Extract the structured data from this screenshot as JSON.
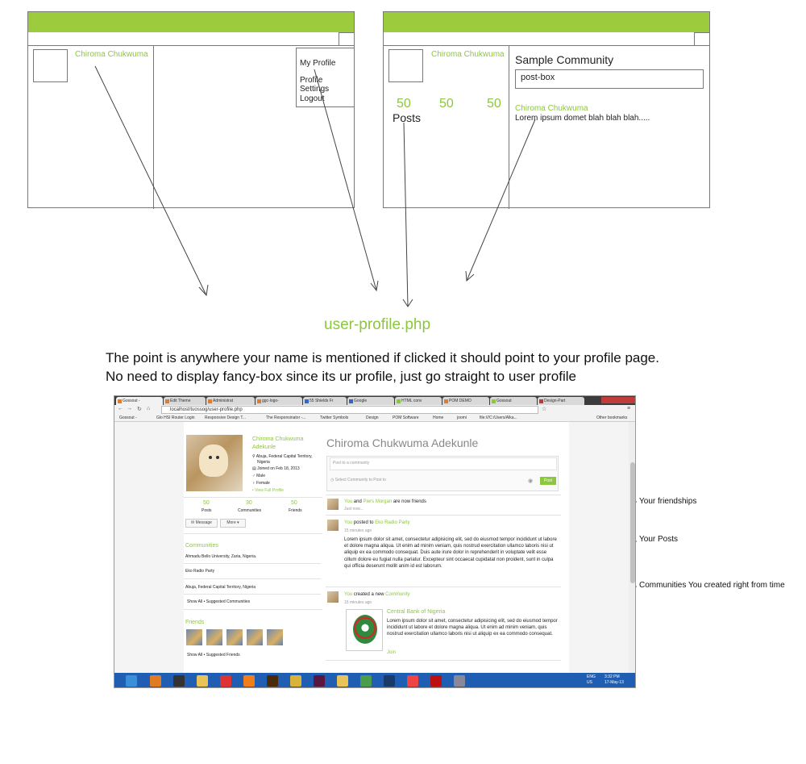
{
  "wireframe_left": {
    "user_name": "Chiroma Chukwuma",
    "menu": [
      "My Profile",
      "Profile Settings",
      "Logout"
    ]
  },
  "wireframe_right": {
    "user_name": "Chiroma Chukwuma",
    "stats": [
      "50",
      "50",
      "50"
    ],
    "posts_label": "Posts",
    "community_title": "Sample Community",
    "post_box": "post-box",
    "post_author": "Chiroma Chukwuma",
    "post_text": "Lorem ipsum domet blah blah blah....."
  },
  "file_label": "user-profile.php",
  "note_lines": [
    "The point is anywhere your name is mentioned if clicked it should point to your profile page.",
    "No need to display fancy-box since its ur profile, just go straight to user profile"
  ],
  "side_labels": {
    "friendships": "Your friendships",
    "posts": "Your Posts",
    "communities": "Communities You created right from time"
  },
  "browser": {
    "tabs": [
      "Gossout -",
      "Edit Theme",
      "Administrat",
      "ggc-logo-",
      "55 Shields Fr",
      "Google",
      "HTML conv",
      "POM DEMO",
      "Gossout",
      "Design-Part"
    ],
    "url": "localhost/tuossog/user-profile.php",
    "bookmarks": [
      "Gossout -",
      "Glo HSI Router Login",
      "Responsive Design T...",
      "The Responsinator -...",
      "Twitter Symbols",
      "Design",
      "POM Software",
      "Home",
      "joomi",
      "file:///C:/Users/Alka...",
      "Other bookmarks"
    ]
  },
  "profile": {
    "name_line1": "Chiroma Chukwuma",
    "name_line2": "Adekunle",
    "location_line1": "Abuja, Federal Capital Territory,",
    "location_line2": "Nigeria",
    "joined": "Joined on Feb 18, 2013",
    "gender1": "Male",
    "gender2": "Female",
    "view_full": "View Full Profile",
    "stats": [
      {
        "value": "50",
        "label": "Posts"
      },
      {
        "value": "30",
        "label": "Communities"
      },
      {
        "value": "50",
        "label": "Friends"
      }
    ],
    "message_btn": "Message",
    "more_btn": "More",
    "communities_title": "Communities",
    "communities": [
      "Ahmadu Bello University, Zaria, Nigeria.",
      "Eko Radio Party",
      "Abuja, Federal Capital Territory, Nigeria"
    ],
    "communities_links": "Show All  •  Suggested Communities",
    "friends_title": "Friends",
    "friends_links": "Show All  •  Suggested Friends"
  },
  "feed": {
    "heading": "Chiroma Chukwuma Adekunle",
    "post_placeholder": "Post to a community",
    "select_community": "Select Community to Post to",
    "post_button": "Post",
    "item1": {
      "you": "You",
      "and": "and",
      "name": "Piers Morgan",
      "rest": "are now friends",
      "time": "Just now..."
    },
    "item2": {
      "you": "You",
      "action": "posted to",
      "target": "Eko Radio Party",
      "time": "15 minutes ago",
      "body": "Lorem ipsum dolor sit amet, consectetur adipisicing elit, sed do eiusmod tempor incididunt ut labore et dolore magna aliqua. Ut enim ad minim veniam, quis nostrud exercitation ullamco laboris nisi ut aliquip ex ea commodo consequat. Duis aute irure dolor in reprehenderit in voluptate velit esse cillum dolore eu fugiat nulla pariatur. Excepteur sint occaecat cupidatat non proident, sunt in culpa qui officia deserunt mollit anim id est laborum."
    },
    "item3": {
      "you": "You",
      "action": "created a new",
      "target": "Community",
      "time": "15 minutes ago",
      "community_name": "Central Bank of Nigeria",
      "body": "Lorem ipsum dolor sit amet, consectetur adipisicing elit, sed do eiusmod tempor incididunt ut labore et dolore magna aliqua. Ut enim ad minim veniam, quis nostrud exercitation ullamco laboris nisi ut aliquip ex ea commodo consequat.",
      "join": "Join"
    }
  },
  "taskbar": {
    "lang": "ENG",
    "region": "US",
    "time": "3:32 PM",
    "date": "17-May-13"
  }
}
